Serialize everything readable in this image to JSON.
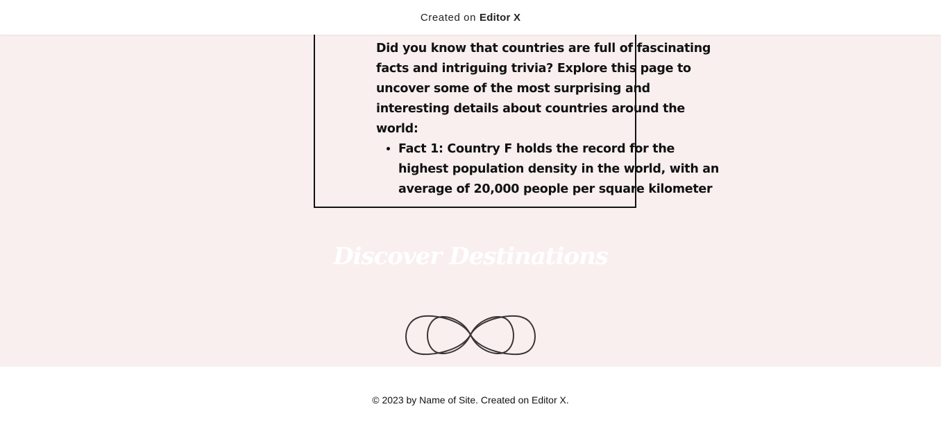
{
  "banner": {
    "prefix": "Created on",
    "brand": "Editor X"
  },
  "article": {
    "intro": "Did you know that countries are full of fascinating facts and intriguing trivia? Explore this page to uncover some of the most surprising and interesting details about countries around the world:",
    "facts": [
      "Fact 1: Country F holds the record for the highest population density in the world, with an average of 20,000 people per square kilometer"
    ]
  },
  "section": {
    "heading": "Discover Destinations"
  },
  "footer": {
    "text": "© 2023 by Name of Site. Created on Editor X."
  },
  "colors": {
    "page_background": "#f9efef",
    "heading_text": "#ffffff",
    "ornament_stroke": "#3a3434"
  },
  "icons": {
    "ornament": "infinity-knot-divider"
  }
}
